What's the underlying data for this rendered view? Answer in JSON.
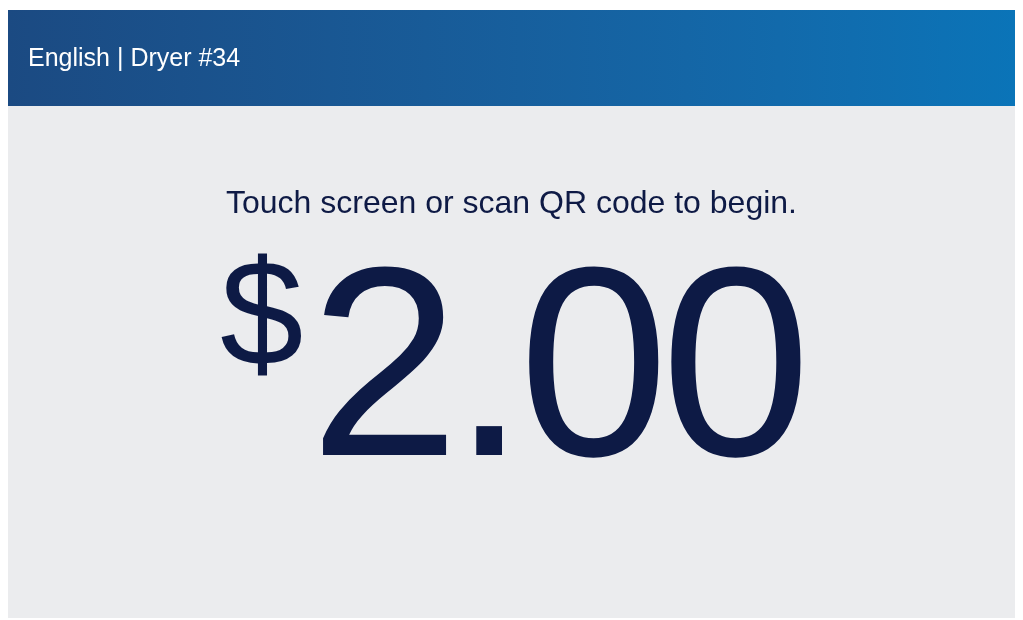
{
  "header": {
    "title": "English | Dryer #34"
  },
  "prompt": "Touch screen or scan QR code to begin.",
  "price": {
    "currency": "$",
    "amount": "2.00"
  }
}
